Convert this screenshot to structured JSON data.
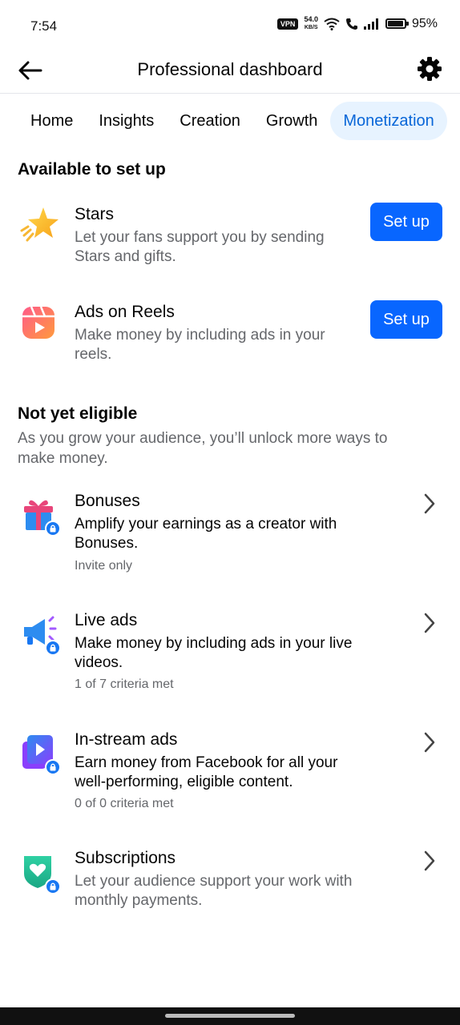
{
  "status_bar": {
    "time": "7:54",
    "vpn": "VPN",
    "speed_value": "54.0",
    "speed_unit": "KB/S",
    "battery": "95%",
    "battery_level": 0.95
  },
  "header": {
    "title": "Professional dashboard"
  },
  "tabs": [
    {
      "label": "Home"
    },
    {
      "label": "Insights"
    },
    {
      "label": "Creation"
    },
    {
      "label": "Growth"
    },
    {
      "label": "Monetization"
    }
  ],
  "available": {
    "title": "Available to set up",
    "items": [
      {
        "title": "Stars",
        "desc_line1": "Let your fans support you by sending",
        "desc_line2": "Stars and gifts.",
        "button": "Set up"
      },
      {
        "title": "Ads on Reels",
        "desc_line1": "Make money by including ads in your",
        "desc_line2": "reels.",
        "button": "Set up"
      }
    ]
  },
  "not_eligible": {
    "title": "Not yet eligible",
    "desc_line1": "As you grow your audience, you’ll unlock more ways to",
    "desc_line2": "make money.",
    "items": [
      {
        "title": "Bonuses",
        "desc_line1": "Amplify your earnings as a creator with",
        "desc_line2": "Bonuses.",
        "meta": "Invite only"
      },
      {
        "title": "Live ads",
        "desc_line1": "Make money by including ads in your live",
        "desc_line2": "videos.",
        "meta": "1 of 7 criteria met"
      },
      {
        "title": "In-stream ads",
        "desc_line1": "Earn money from Facebook for all your",
        "desc_line2": "well-performing, eligible content.",
        "meta": "0 of 0 criteria met"
      },
      {
        "title": "Subscriptions",
        "desc_line1": "Let your audience support your work with",
        "desc_line2": "monthly payments."
      }
    ]
  },
  "colors": {
    "accent": "#0866ff",
    "active_tab_bg": "#e7f3ff",
    "active_tab_text": "#0866d8",
    "secondary_text": "#65676b"
  },
  "icons": {
    "back": "arrow-left-icon",
    "settings": "gear-icon",
    "stars": "star-icon",
    "reels": "reels-icon",
    "bonuses": "gift-icon",
    "live_ads": "megaphone-icon",
    "instream": "play-video-icon",
    "subscriptions": "heart-shield-icon",
    "lock": "lock-icon",
    "chevron": "chevron-right-icon"
  }
}
